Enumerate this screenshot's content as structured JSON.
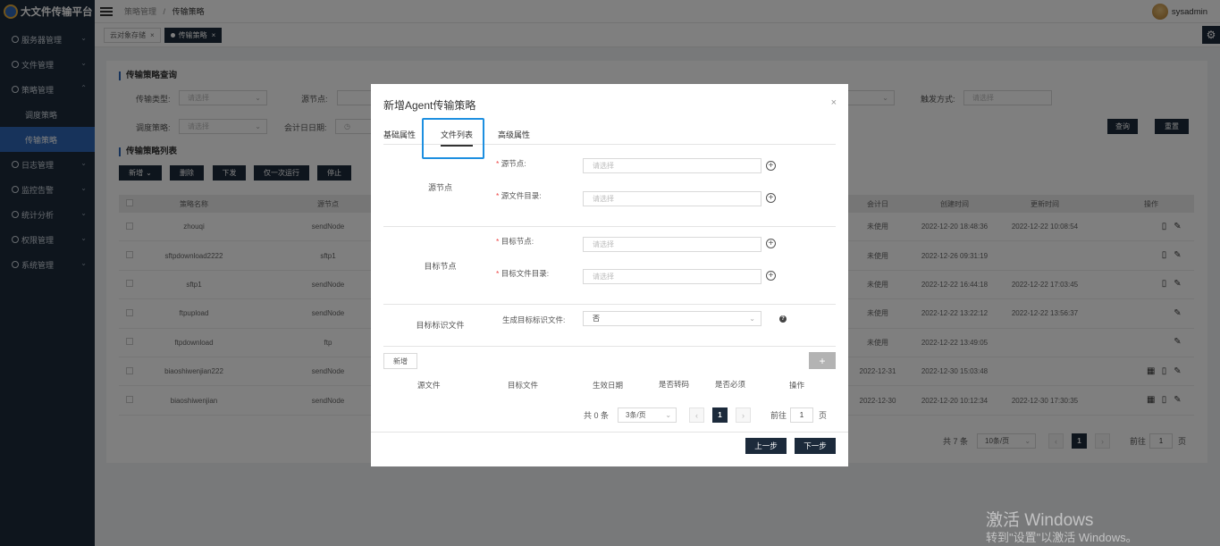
{
  "app": {
    "title": "大文件传输平台"
  },
  "sidebar": {
    "items": [
      {
        "label": "服务器管理"
      },
      {
        "label": "文件管理"
      },
      {
        "label": "策略管理"
      },
      {
        "label": "日志管理"
      },
      {
        "label": "监控告警"
      },
      {
        "label": "统计分析"
      },
      {
        "label": "权限管理"
      },
      {
        "label": "系统管理"
      }
    ],
    "sub_items": [
      {
        "label": "调度策略"
      },
      {
        "label": "传输策略"
      }
    ]
  },
  "header": {
    "breadcrumb": {
      "parent": "策略管理",
      "sep": "/",
      "current": "传输策略"
    },
    "user": "sysadmin"
  },
  "page_tabs": [
    {
      "label": "云对象存储",
      "close": "×"
    },
    {
      "label": "传输策略",
      "close": "×"
    }
  ],
  "query": {
    "title": "传输策略查询",
    "transfer_type_label": "传输类型:",
    "source_node_label": "源节点:",
    "trigger_label": "触发方式:",
    "schedule_label": "调度策略:",
    "acct_date_label": "会计日日期:",
    "placeholder": "请选择",
    "query_button": "查询",
    "reset_button": "重置"
  },
  "list": {
    "title": "传输策略列表",
    "buttons": {
      "add": "新增",
      "delete": "删除",
      "publish": "下发",
      "run_once": "仅一次运行",
      "stop": "停止"
    },
    "columns": [
      "策略名称",
      "源节点",
      "会计日",
      "创建时间",
      "更新时间",
      "操作"
    ],
    "rows": [
      {
        "name": "zhouqi",
        "source": "sendNode",
        "acct": "未使用",
        "created": "2022-12-20 18:48:36",
        "updated": "2022-12-22 10:08:54"
      },
      {
        "name": "sftpdownload2222",
        "source": "sftp1",
        "acct": "未使用",
        "created": "2022-12-26 09:31:19",
        "updated": ""
      },
      {
        "name": "sftp1",
        "source": "sendNode",
        "acct": "未使用",
        "created": "2022-12-22 16:44:18",
        "updated": "2022-12-22 17:03:45"
      },
      {
        "name": "ftpupload",
        "source": "sendNode",
        "acct": "未使用",
        "created": "2022-12-22 13:22:12",
        "updated": "2022-12-22 13:56:37"
      },
      {
        "name": "ftpdownload",
        "source": "ftp",
        "acct": "未使用",
        "created": "2022-12-22 13:49:05",
        "updated": ""
      },
      {
        "name": "biaoshiwenjian222",
        "source": "sendNode",
        "acct": "2022-12-31",
        "created": "2022-12-30 15:03:48",
        "updated": ""
      },
      {
        "name": "biaoshiwenjian",
        "source": "sendNode",
        "acct": "2022-12-30",
        "created": "2022-12-20 10:12:34",
        "updated": "2022-12-30 17:30:35"
      }
    ],
    "pager": {
      "total": "共 7 条",
      "size": "10条/页",
      "page": "1",
      "goto": "前往",
      "goto_value": "1",
      "unit": "页"
    }
  },
  "modal": {
    "title": "新增Agent传输策略",
    "close": "×",
    "tabs": [
      "基础属性",
      "文件列表",
      "高级属性"
    ],
    "source_group": "源节点",
    "source_node_label": "源节点:",
    "source_dir_label": "源文件目录:",
    "target_group": "目标节点",
    "target_node_label": "目标节点:",
    "target_dir_label": "目标文件目录:",
    "flag_group": "目标标识文件",
    "flag_label": "生成目标标识文件:",
    "flag_value": "否",
    "placeholder": "请选择",
    "required": "*",
    "add_button": "新增",
    "add_plus": "+",
    "columns": [
      "源文件",
      "目标文件",
      "生效日期",
      "是否转码",
      "是否必须",
      "操作"
    ],
    "pager": {
      "total": "共 0 条",
      "size": "3条/页",
      "page": "1",
      "goto": "前往",
      "goto_value": "1",
      "unit": "页"
    },
    "prev_button": "上一步",
    "next_button": "下一步"
  },
  "watermark": {
    "line1": "激活 Windows",
    "line2": "转到\"设置\"以激活 Windows。"
  }
}
